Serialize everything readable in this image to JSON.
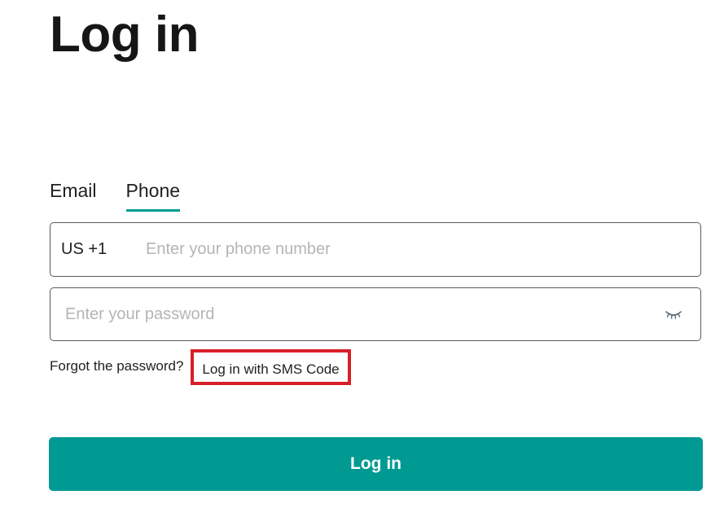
{
  "page": {
    "title": "Log in"
  },
  "tabs": [
    {
      "label": "Email",
      "active": false
    },
    {
      "label": "Phone",
      "active": true
    }
  ],
  "phone": {
    "country_code": "US +1",
    "placeholder": "Enter your phone number",
    "value": ""
  },
  "password": {
    "placeholder": "Enter your password",
    "value": "",
    "toggle_icon": "eye-closed-icon"
  },
  "links": {
    "forgot": "Forgot the password?",
    "sms": "Log in with SMS Code"
  },
  "submit": {
    "label": "Log in"
  },
  "colors": {
    "accent": "#009a93",
    "highlight": "#d71f29",
    "text": "#1f1f1f",
    "placeholder": "#b5b5b5"
  }
}
